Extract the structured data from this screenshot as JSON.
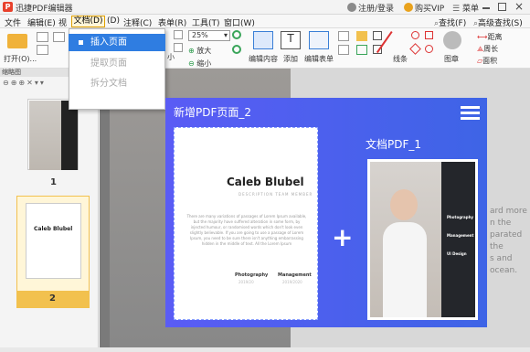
{
  "app": {
    "title": "迅捷PDF编辑器",
    "logo": "P"
  },
  "titlebar": {
    "login": "注册/登录",
    "vip": "购买VIP",
    "menu": "菜单"
  },
  "menubar": {
    "items": [
      "文件",
      "编辑(E)",
      "视",
      "文档(D)",
      "(D)",
      "注释(C)",
      "表单(R)",
      "工具(T)",
      "窗口(W)"
    ],
    "right": [
      "查找(F)",
      "高级查找(S)"
    ]
  },
  "toolbar": {
    "open": "打开(O)...",
    "zoom": "25%",
    "zoom_in": "放大",
    "zoom_out": "缩小",
    "edit_content": "编辑内容",
    "add": "添加",
    "edit_form": "编辑表单",
    "line": "线条",
    "shape": "图章",
    "distance": "距离",
    "perimeter": "周长",
    "area": "面积",
    "more": "小"
  },
  "sidebar": {
    "title": "缩略图",
    "pages": [
      "1",
      "2"
    ]
  },
  "dropdown": {
    "items": [
      "插入页面",
      "提取页面",
      "拆分文档"
    ]
  },
  "overlay": {
    "title": "新增PDF页面_2",
    "doc_label": "文档PDF_1",
    "plus": "+"
  },
  "newpage": {
    "name": "Caleb Blubel",
    "subtitle": "DESCRIPTION TEAM MEMBER",
    "body": "There are many variations of passages of Lorem Ipsum available, but the majority have suffered alteration in some form, by injected humour, or randomised words which don't look even slightly believable. If you are going to use a passage of Lorem Ipsum, you need to be sure there isn't anything embarrassing hidden in the middle of text. All the Lorem Ipsum",
    "roles": [
      "Photography",
      "Management"
    ],
    "role_sub": [
      "2019/20",
      "2019/2020"
    ]
  },
  "thumb2": {
    "name": "Caleb Blubel"
  },
  "docthumb": {
    "labels": [
      "Photography",
      "Management",
      "UI Design"
    ]
  },
  "bg_text": [
    "ard more",
    "n the",
    "parated the",
    "s and",
    "ocean."
  ],
  "colors": {
    "accent": "#2f7de1",
    "overlay": "#4b5ff0",
    "selected": "#f2c14e"
  }
}
